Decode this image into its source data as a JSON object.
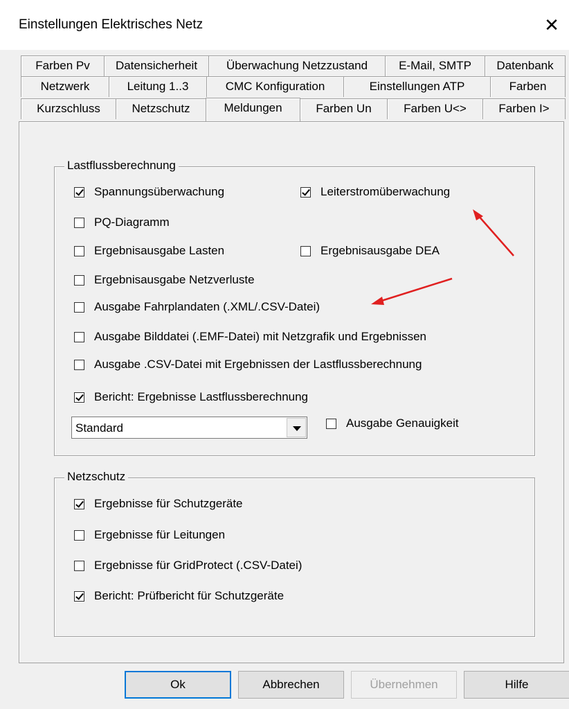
{
  "window": {
    "title": "Einstellungen Elektrisches Netz",
    "close_glyph": "✕"
  },
  "tabs": {
    "row1": [
      "Farben Pv",
      "Datensicherheit",
      "Überwachung Netzzustand",
      "E-Mail, SMTP",
      "Datenbank"
    ],
    "row2": [
      "Netzwerk",
      "Leitung 1..3",
      "CMC Konfiguration",
      "Einstellungen ATP",
      "Farben"
    ],
    "row3": [
      "Kurzschluss",
      "Netzschutz",
      "Meldungen",
      "Farben Un",
      "Farben U<>",
      "Farben I>"
    ],
    "active": "Meldungen"
  },
  "lastfluss": {
    "legend": "Lastflussberechnung",
    "options": [
      {
        "label": "Spannungsüberwachung",
        "checked": true
      },
      {
        "label": "Leiterstromüberwachung",
        "checked": true
      },
      {
        "label": "PQ-Diagramm",
        "checked": false
      },
      {
        "label": "Ergebnisausgabe Lasten",
        "checked": false
      },
      {
        "label": "Ergebnisausgabe DEA",
        "checked": false
      },
      {
        "label": "Ergebnisausgabe Netzverluste",
        "checked": false
      },
      {
        "label": "Ausgabe Fahrplandaten (.XML/.CSV-Datei)",
        "checked": false
      },
      {
        "label": "Ausgabe Bilddatei (.EMF-Datei) mit Netzgrafik und Ergebnissen",
        "checked": false
      },
      {
        "label": "Ausgabe .CSV-Datei mit Ergebnissen der Lastflussberechnung",
        "checked": false
      },
      {
        "label": "Bericht: Ergebnisse Lastflussberechnung",
        "checked": true
      },
      {
        "label": "Ausgabe Genauigkeit",
        "checked": false
      }
    ],
    "report_type": "Standard"
  },
  "netzschutz": {
    "legend": "Netzschutz",
    "options": [
      {
        "label": "Ergebnisse für Schutzgeräte",
        "checked": true
      },
      {
        "label": "Ergebnisse für Leitungen",
        "checked": false
      },
      {
        "label": "Ergebnisse für GridProtect (.CSV-Datei)",
        "checked": false
      },
      {
        "label": "Bericht: Prüfbericht für Schutzgeräte",
        "checked": true
      }
    ]
  },
  "buttons": {
    "ok": "Ok",
    "cancel": "Abbrechen",
    "apply": "Übernehmen",
    "help": "Hilfe"
  },
  "annotation_color": "#e02020"
}
